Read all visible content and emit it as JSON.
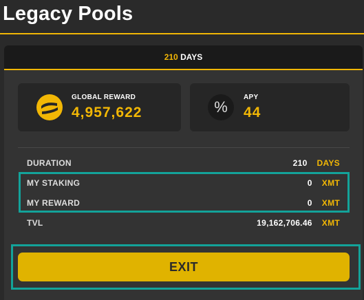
{
  "page": {
    "title": "Legacy Pools"
  },
  "pool": {
    "tab": {
      "duration_num": "210",
      "duration_unit": "DAYS"
    },
    "global_reward": {
      "label": "GLOBAL REWARD",
      "value": "4,957,622",
      "icon": "token-logo-icon"
    },
    "apy": {
      "label": "APY",
      "value": "44",
      "icon": "percent-icon",
      "icon_glyph": "%"
    },
    "rows": {
      "duration": {
        "label": "DURATION",
        "value": "210",
        "unit": "DAYS"
      },
      "my_staking": {
        "label": "MY STAKING",
        "value": "0",
        "unit": "XMT"
      },
      "my_reward": {
        "label": "MY REWARD",
        "value": "0",
        "unit": "XMT"
      },
      "tvl": {
        "label": "TVL",
        "value": "19,162,706.46",
        "unit": "XMT"
      }
    },
    "exit_label": "EXIT"
  },
  "colors": {
    "accent": "#f2b705",
    "highlight": "#13a39a",
    "background": "#2a2a2a",
    "card": "#333333"
  }
}
